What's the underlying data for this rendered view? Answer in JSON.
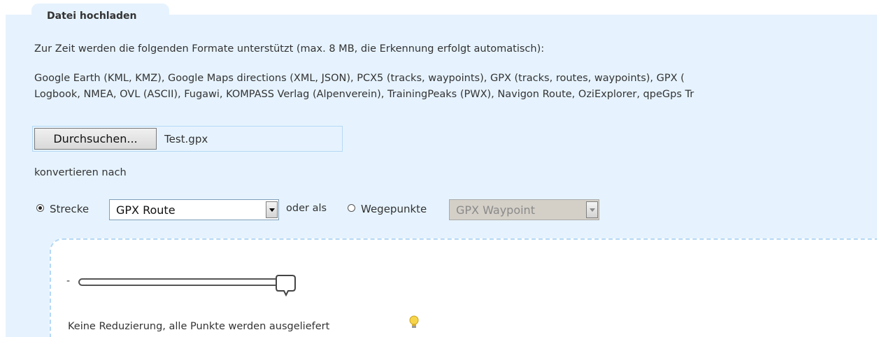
{
  "tab": {
    "title": "Datei hochladen"
  },
  "intro_text": "Zur Zeit werden die folgenden Formate unterstützt (max. 8 MB, die Erkennung erfolgt automatisch):",
  "formats": {
    "line1": "Google Earth (KML, KMZ), Google Maps directions (XML, JSON), PCX5 (tracks, waypoints), GPX (tracks, routes, waypoints), GPX (",
    "line2": "Logbook, NMEA, OVL (ASCII), Fugawi, KOMPASS Verlag (Alpenverein), TrainingPeaks (PWX), Navigon Route, OziExplorer, qpeGps Tr"
  },
  "file_upload": {
    "button_label": "Durchsuchen...",
    "file_name": "Test.gpx"
  },
  "convert_label": "konvertieren nach",
  "options": {
    "track": {
      "label": "Strecke",
      "checked": true,
      "select_value": "GPX Route",
      "enabled": true
    },
    "or_label": "oder als",
    "waypoints": {
      "label": "Wegepunkte",
      "checked": false,
      "select_value": "GPX Waypoint",
      "enabled": false
    }
  },
  "reduction": {
    "minus_label": "-",
    "slider_value_fraction": 1.0,
    "info_text": "Keine Reduzierung, alle Punkte werden ausgeliefert",
    "icon": "lightbulb-icon"
  },
  "colors": {
    "panel_background": "#e6f3fe",
    "border_accent": "#b5d8f5",
    "bulb": "#f7d54a"
  }
}
